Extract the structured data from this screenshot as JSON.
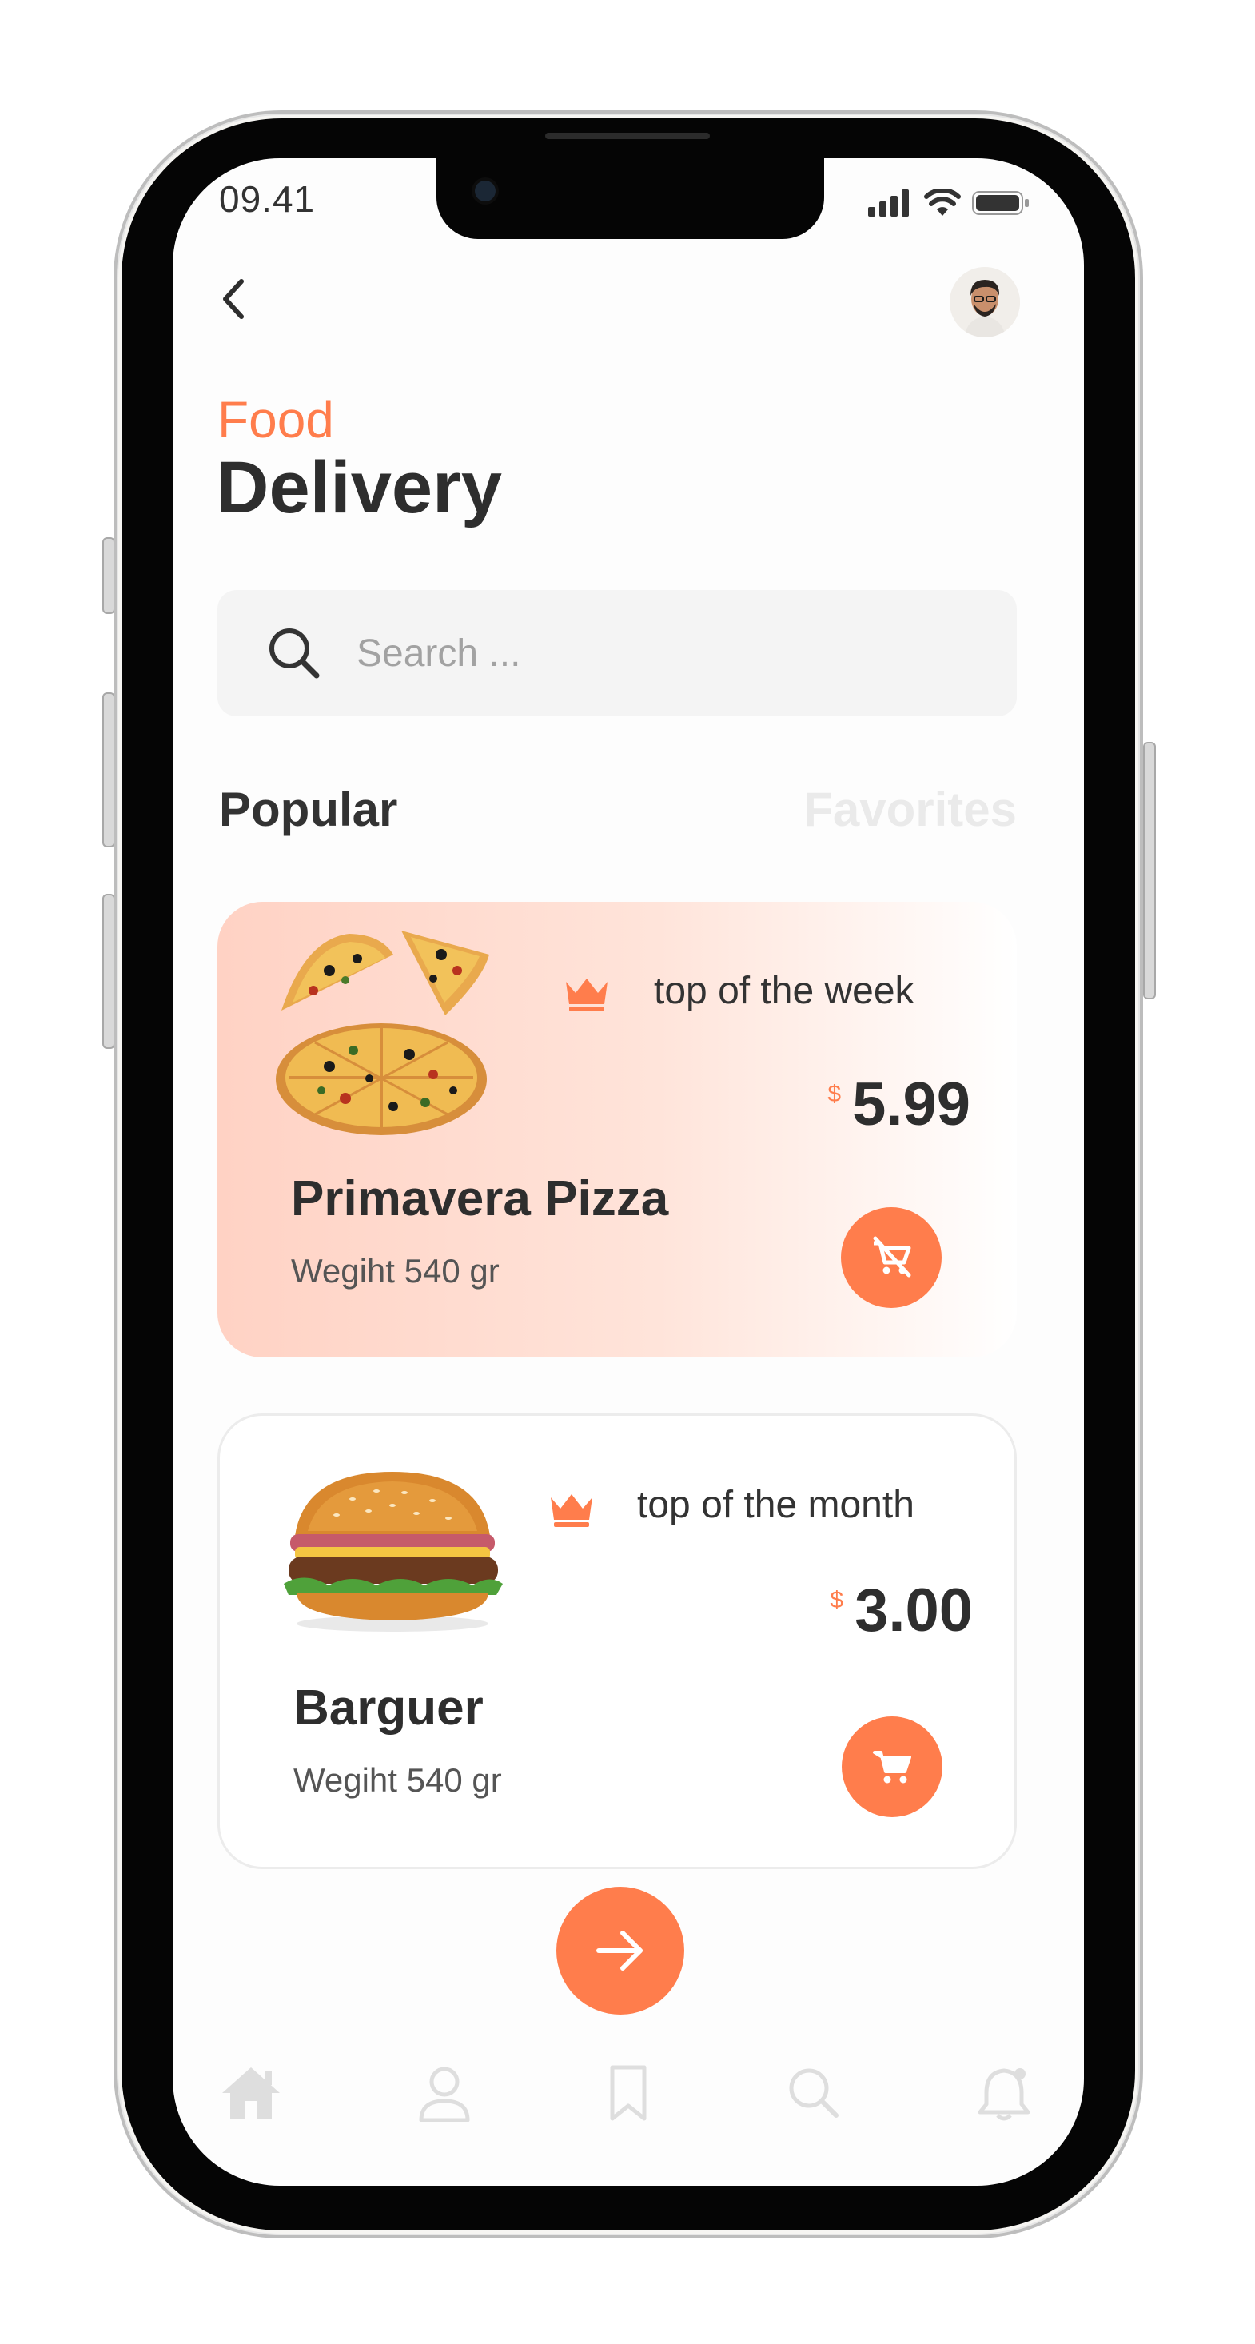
{
  "status_bar": {
    "time": "09.41"
  },
  "header": {
    "title_accent": "Food",
    "title_main": "Delivery"
  },
  "search": {
    "placeholder": "Search ..."
  },
  "tabs": [
    {
      "label": "Popular",
      "active": true
    },
    {
      "label": "Favorites",
      "active": false
    }
  ],
  "items": [
    {
      "name": "Primavera Pizza",
      "weight": "Wegiht 540 gr",
      "badge": "top of the week",
      "currency": "$",
      "price": "5.99",
      "image": "pizza",
      "cart_icon": "remove-from-cart-icon"
    },
    {
      "name": "Barguer",
      "weight": "Wegiht 540 gr",
      "badge": "top of the month",
      "currency": "$",
      "price": "3.00",
      "image": "burger",
      "cart_icon": "add-to-cart-icon"
    }
  ],
  "bottom_nav": [
    "home-icon",
    "profile-icon",
    "bookmark-icon",
    "search-icon",
    "notification-icon"
  ],
  "colors": {
    "accent": "#ff7d4c",
    "text_dark": "#2e2e2e",
    "card_tint": "#ffd2c4",
    "inactive": "#e3e3e3"
  }
}
